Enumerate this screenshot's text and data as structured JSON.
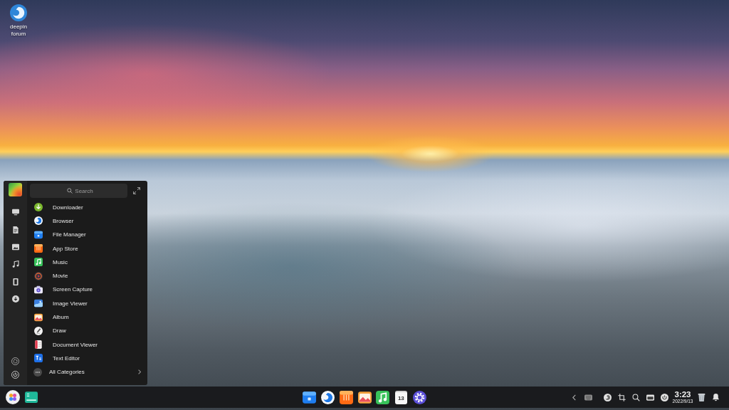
{
  "desktop": {
    "shortcuts": [
      {
        "label": "deepin forum"
      }
    ]
  },
  "launcher": {
    "sidebar_top": [
      {
        "kind": "computer"
      },
      {
        "kind": "documents"
      },
      {
        "kind": "pictures"
      },
      {
        "kind": "music"
      },
      {
        "kind": "videos"
      },
      {
        "kind": "downloads"
      }
    ],
    "sidebar_bottom": [
      {
        "kind": "settings"
      },
      {
        "kind": "power"
      }
    ],
    "search": {
      "placeholder": "Search"
    },
    "apps": [
      {
        "name": "Downloader",
        "kind": "downloader"
      },
      {
        "name": "Browser",
        "kind": "browser"
      },
      {
        "name": "File Manager",
        "kind": "files"
      },
      {
        "name": "App Store",
        "kind": "store"
      },
      {
        "name": "Music",
        "kind": "music"
      },
      {
        "name": "Movie",
        "kind": "movie"
      },
      {
        "name": "Screen Capture",
        "kind": "capture"
      },
      {
        "name": "Image Viewer",
        "kind": "viewer"
      },
      {
        "name": "Album",
        "kind": "album"
      },
      {
        "name": "Draw",
        "kind": "draw"
      },
      {
        "name": "Document Viewer",
        "kind": "reader"
      },
      {
        "name": "Text Editor",
        "kind": "editor"
      }
    ],
    "all_categories": {
      "label": "All Categories"
    }
  },
  "taskbar": {
    "left": [
      {
        "kind": "launcher"
      },
      {
        "kind": "workspaces"
      }
    ],
    "apps": [
      {
        "kind": "files"
      },
      {
        "kind": "browser"
      },
      {
        "kind": "store"
      },
      {
        "kind": "album"
      },
      {
        "kind": "music"
      },
      {
        "kind": "calendar",
        "label": "13"
      },
      {
        "kind": "settings"
      }
    ],
    "tray": [
      {
        "kind": "chevron"
      },
      {
        "kind": "keyboard"
      },
      {
        "kind": "assistant"
      },
      {
        "kind": "screenshot"
      },
      {
        "kind": "search"
      },
      {
        "kind": "multitask"
      },
      {
        "kind": "power"
      }
    ],
    "clock": {
      "time": "3:23",
      "date": "2022/9/13"
    },
    "tray_end": [
      {
        "kind": "trash"
      },
      {
        "kind": "notifications"
      }
    ]
  }
}
